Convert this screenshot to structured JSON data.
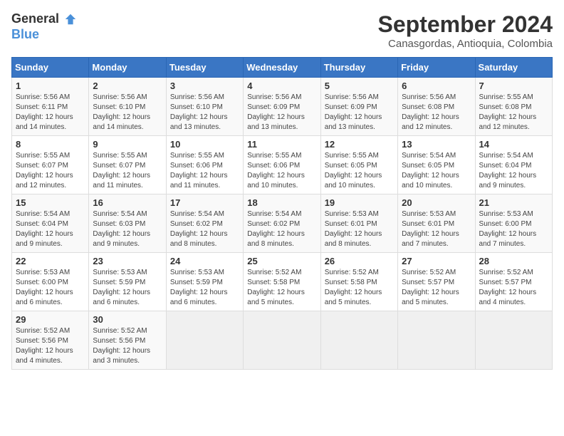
{
  "header": {
    "logo_line1": "General",
    "logo_line2": "Blue",
    "title": "September 2024",
    "subtitle": "Canasgordas, Antioquia, Colombia"
  },
  "weekdays": [
    "Sunday",
    "Monday",
    "Tuesday",
    "Wednesday",
    "Thursday",
    "Friday",
    "Saturday"
  ],
  "weeks": [
    [
      {
        "day": "1",
        "info": "Sunrise: 5:56 AM\nSunset: 6:11 PM\nDaylight: 12 hours\nand 14 minutes."
      },
      {
        "day": "2",
        "info": "Sunrise: 5:56 AM\nSunset: 6:10 PM\nDaylight: 12 hours\nand 14 minutes."
      },
      {
        "day": "3",
        "info": "Sunrise: 5:56 AM\nSunset: 6:10 PM\nDaylight: 12 hours\nand 13 minutes."
      },
      {
        "day": "4",
        "info": "Sunrise: 5:56 AM\nSunset: 6:09 PM\nDaylight: 12 hours\nand 13 minutes."
      },
      {
        "day": "5",
        "info": "Sunrise: 5:56 AM\nSunset: 6:09 PM\nDaylight: 12 hours\nand 13 minutes."
      },
      {
        "day": "6",
        "info": "Sunrise: 5:56 AM\nSunset: 6:08 PM\nDaylight: 12 hours\nand 12 minutes."
      },
      {
        "day": "7",
        "info": "Sunrise: 5:55 AM\nSunset: 6:08 PM\nDaylight: 12 hours\nand 12 minutes."
      }
    ],
    [
      {
        "day": "8",
        "info": "Sunrise: 5:55 AM\nSunset: 6:07 PM\nDaylight: 12 hours\nand 12 minutes."
      },
      {
        "day": "9",
        "info": "Sunrise: 5:55 AM\nSunset: 6:07 PM\nDaylight: 12 hours\nand 11 minutes."
      },
      {
        "day": "10",
        "info": "Sunrise: 5:55 AM\nSunset: 6:06 PM\nDaylight: 12 hours\nand 11 minutes."
      },
      {
        "day": "11",
        "info": "Sunrise: 5:55 AM\nSunset: 6:06 PM\nDaylight: 12 hours\nand 10 minutes."
      },
      {
        "day": "12",
        "info": "Sunrise: 5:55 AM\nSunset: 6:05 PM\nDaylight: 12 hours\nand 10 minutes."
      },
      {
        "day": "13",
        "info": "Sunrise: 5:54 AM\nSunset: 6:05 PM\nDaylight: 12 hours\nand 10 minutes."
      },
      {
        "day": "14",
        "info": "Sunrise: 5:54 AM\nSunset: 6:04 PM\nDaylight: 12 hours\nand 9 minutes."
      }
    ],
    [
      {
        "day": "15",
        "info": "Sunrise: 5:54 AM\nSunset: 6:04 PM\nDaylight: 12 hours\nand 9 minutes."
      },
      {
        "day": "16",
        "info": "Sunrise: 5:54 AM\nSunset: 6:03 PM\nDaylight: 12 hours\nand 9 minutes."
      },
      {
        "day": "17",
        "info": "Sunrise: 5:54 AM\nSunset: 6:02 PM\nDaylight: 12 hours\nand 8 minutes."
      },
      {
        "day": "18",
        "info": "Sunrise: 5:54 AM\nSunset: 6:02 PM\nDaylight: 12 hours\nand 8 minutes."
      },
      {
        "day": "19",
        "info": "Sunrise: 5:53 AM\nSunset: 6:01 PM\nDaylight: 12 hours\nand 8 minutes."
      },
      {
        "day": "20",
        "info": "Sunrise: 5:53 AM\nSunset: 6:01 PM\nDaylight: 12 hours\nand 7 minutes."
      },
      {
        "day": "21",
        "info": "Sunrise: 5:53 AM\nSunset: 6:00 PM\nDaylight: 12 hours\nand 7 minutes."
      }
    ],
    [
      {
        "day": "22",
        "info": "Sunrise: 5:53 AM\nSunset: 6:00 PM\nDaylight: 12 hours\nand 6 minutes."
      },
      {
        "day": "23",
        "info": "Sunrise: 5:53 AM\nSunset: 5:59 PM\nDaylight: 12 hours\nand 6 minutes."
      },
      {
        "day": "24",
        "info": "Sunrise: 5:53 AM\nSunset: 5:59 PM\nDaylight: 12 hours\nand 6 minutes."
      },
      {
        "day": "25",
        "info": "Sunrise: 5:52 AM\nSunset: 5:58 PM\nDaylight: 12 hours\nand 5 minutes."
      },
      {
        "day": "26",
        "info": "Sunrise: 5:52 AM\nSunset: 5:58 PM\nDaylight: 12 hours\nand 5 minutes."
      },
      {
        "day": "27",
        "info": "Sunrise: 5:52 AM\nSunset: 5:57 PM\nDaylight: 12 hours\nand 5 minutes."
      },
      {
        "day": "28",
        "info": "Sunrise: 5:52 AM\nSunset: 5:57 PM\nDaylight: 12 hours\nand 4 minutes."
      }
    ],
    [
      {
        "day": "29",
        "info": "Sunrise: 5:52 AM\nSunset: 5:56 PM\nDaylight: 12 hours\nand 4 minutes."
      },
      {
        "day": "30",
        "info": "Sunrise: 5:52 AM\nSunset: 5:56 PM\nDaylight: 12 hours\nand 3 minutes."
      },
      {
        "day": "",
        "info": ""
      },
      {
        "day": "",
        "info": ""
      },
      {
        "day": "",
        "info": ""
      },
      {
        "day": "",
        "info": ""
      },
      {
        "day": "",
        "info": ""
      }
    ]
  ]
}
